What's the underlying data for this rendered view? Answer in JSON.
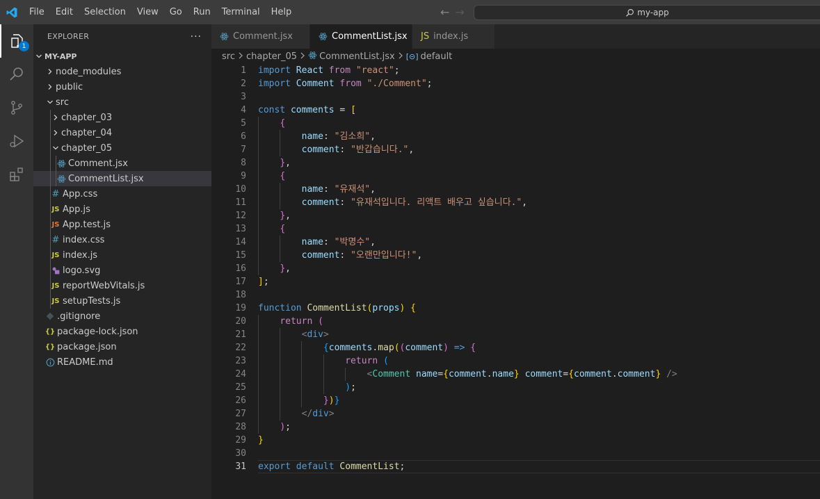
{
  "menu": [
    "File",
    "Edit",
    "Selection",
    "View",
    "Go",
    "Run",
    "Terminal",
    "Help"
  ],
  "search": {
    "text": "my-app"
  },
  "activity": {
    "badge": "1"
  },
  "explorer": {
    "title": "EXPLORER",
    "more": "···",
    "root": "MY-APP",
    "items": [
      {
        "label": "node_modules",
        "type": "folder",
        "depth": 0,
        "expanded": false
      },
      {
        "label": "public",
        "type": "folder",
        "depth": 0,
        "expanded": false
      },
      {
        "label": "src",
        "type": "folder",
        "depth": 0,
        "expanded": true
      },
      {
        "label": "chapter_03",
        "type": "folder",
        "depth": 1,
        "expanded": false
      },
      {
        "label": "chapter_04",
        "type": "folder",
        "depth": 1,
        "expanded": false
      },
      {
        "label": "chapter_05",
        "type": "folder",
        "depth": 1,
        "expanded": true
      },
      {
        "label": "Comment.jsx",
        "type": "react",
        "depth": 2
      },
      {
        "label": "CommentList.jsx",
        "type": "react",
        "depth": 2,
        "selected": true
      },
      {
        "label": "App.css",
        "type": "css",
        "depth": 1
      },
      {
        "label": "App.js",
        "type": "js",
        "depth": 1
      },
      {
        "label": "App.test.js",
        "type": "test",
        "depth": 1
      },
      {
        "label": "index.css",
        "type": "css",
        "depth": 1
      },
      {
        "label": "index.js",
        "type": "js",
        "depth": 1
      },
      {
        "label": "logo.svg",
        "type": "svg",
        "depth": 1
      },
      {
        "label": "reportWebVitals.js",
        "type": "js",
        "depth": 1
      },
      {
        "label": "setupTests.js",
        "type": "js",
        "depth": 1
      },
      {
        "label": ".gitignore",
        "type": "git",
        "depth": 0
      },
      {
        "label": "package-lock.json",
        "type": "json",
        "depth": 0
      },
      {
        "label": "package.json",
        "type": "json",
        "depth": 0
      },
      {
        "label": "README.md",
        "type": "info",
        "depth": 0
      }
    ]
  },
  "tabs": [
    {
      "label": "Comment.jsx",
      "icon": "react",
      "active": false
    },
    {
      "label": "CommentList.jsx",
      "icon": "react",
      "active": true,
      "modified": true
    },
    {
      "label": "index.js",
      "icon": "js",
      "active": false
    }
  ],
  "breadcrumb": [
    "src",
    "chapter_05",
    "CommentList.jsx",
    "default"
  ],
  "editor": {
    "current_line": 31,
    "lines": [
      [
        [
          "kw",
          "import "
        ],
        [
          "var",
          "React "
        ],
        [
          "ctl",
          "from "
        ],
        [
          "str",
          "\"react\""
        ],
        [
          "p",
          ";"
        ]
      ],
      [
        [
          "kw",
          "import "
        ],
        [
          "var",
          "Comment "
        ],
        [
          "ctl",
          "from "
        ],
        [
          "str",
          "\"./Comment\""
        ],
        [
          "p",
          ";"
        ]
      ],
      [],
      [
        [
          "kw",
          "const "
        ],
        [
          "var",
          "comments "
        ],
        [
          "p",
          "= "
        ],
        [
          "b1",
          "["
        ]
      ],
      [
        [
          "p",
          "    "
        ],
        [
          "b2",
          "{"
        ]
      ],
      [
        [
          "p",
          "        "
        ],
        [
          "var",
          "name"
        ],
        [
          "p",
          ": "
        ],
        [
          "str",
          "\"김소희\""
        ],
        [
          "p",
          ","
        ]
      ],
      [
        [
          "p",
          "        "
        ],
        [
          "var",
          "comment"
        ],
        [
          "p",
          ": "
        ],
        [
          "str",
          "\"반갑습니다.\""
        ],
        [
          "p",
          ","
        ]
      ],
      [
        [
          "p",
          "    "
        ],
        [
          "b2",
          "}"
        ],
        [
          "p",
          ","
        ]
      ],
      [
        [
          "p",
          "    "
        ],
        [
          "b2",
          "{"
        ]
      ],
      [
        [
          "p",
          "        "
        ],
        [
          "var",
          "name"
        ],
        [
          "p",
          ": "
        ],
        [
          "str",
          "\"유재석\""
        ],
        [
          "p",
          ","
        ]
      ],
      [
        [
          "p",
          "        "
        ],
        [
          "var",
          "comment"
        ],
        [
          "p",
          ": "
        ],
        [
          "str",
          "\"유재석입니다. 리액트 배우고 싶습니다.\""
        ],
        [
          "p",
          ","
        ]
      ],
      [
        [
          "p",
          "    "
        ],
        [
          "b2",
          "}"
        ],
        [
          "p",
          ","
        ]
      ],
      [
        [
          "p",
          "    "
        ],
        [
          "b2",
          "{"
        ]
      ],
      [
        [
          "p",
          "        "
        ],
        [
          "var",
          "name"
        ],
        [
          "p",
          ": "
        ],
        [
          "str",
          "\"박명수\""
        ],
        [
          "p",
          ","
        ]
      ],
      [
        [
          "p",
          "        "
        ],
        [
          "var",
          "comment"
        ],
        [
          "p",
          ": "
        ],
        [
          "str",
          "\"오랜만입니다!\""
        ],
        [
          "p",
          ","
        ]
      ],
      [
        [
          "p",
          "    "
        ],
        [
          "b2",
          "}"
        ],
        [
          "p",
          ","
        ]
      ],
      [
        [
          "b1",
          "]"
        ],
        [
          "p",
          ";"
        ]
      ],
      [],
      [
        [
          "kw",
          "function "
        ],
        [
          "fn",
          "CommentList"
        ],
        [
          "b1",
          "("
        ],
        [
          "var",
          "props"
        ],
        [
          "b1",
          ")"
        ],
        [
          "p",
          " "
        ],
        [
          "b1",
          "{"
        ]
      ],
      [
        [
          "p",
          "    "
        ],
        [
          "ctl",
          "return "
        ],
        [
          "b2",
          "("
        ]
      ],
      [
        [
          "p",
          "        "
        ],
        [
          "tagc",
          "<"
        ],
        [
          "tag",
          "div"
        ],
        [
          "tagc",
          ">"
        ]
      ],
      [
        [
          "p",
          "            "
        ],
        [
          "b3",
          "{"
        ],
        [
          "var",
          "comments"
        ],
        [
          "p",
          "."
        ],
        [
          "fn",
          "map"
        ],
        [
          "b1",
          "("
        ],
        [
          "b2",
          "("
        ],
        [
          "var",
          "comment"
        ],
        [
          "b2",
          ")"
        ],
        [
          "p",
          " "
        ],
        [
          "kw",
          "=>"
        ],
        [
          "p",
          " "
        ],
        [
          "b2",
          "{"
        ]
      ],
      [
        [
          "p",
          "                "
        ],
        [
          "ctl",
          "return "
        ],
        [
          "b3",
          "("
        ]
      ],
      [
        [
          "p",
          "                    "
        ],
        [
          "tagc",
          "<"
        ],
        [
          "cls",
          "Comment "
        ],
        [
          "var",
          "name"
        ],
        [
          "p",
          "="
        ],
        [
          "b1",
          "{"
        ],
        [
          "var",
          "comment"
        ],
        [
          "p",
          "."
        ],
        [
          "var",
          "name"
        ],
        [
          "b1",
          "}"
        ],
        [
          "p",
          " "
        ],
        [
          "var",
          "comment"
        ],
        [
          "p",
          "="
        ],
        [
          "b1",
          "{"
        ],
        [
          "var",
          "comment"
        ],
        [
          "p",
          "."
        ],
        [
          "var",
          "comment"
        ],
        [
          "b1",
          "}"
        ],
        [
          "p",
          " "
        ],
        [
          "tagc",
          "/>"
        ]
      ],
      [
        [
          "p",
          "                "
        ],
        [
          "b3",
          ")"
        ],
        [
          "p",
          ";"
        ]
      ],
      [
        [
          "p",
          "            "
        ],
        [
          "b2",
          "}"
        ],
        [
          "b1",
          ")"
        ],
        [
          "b3",
          "}"
        ]
      ],
      [
        [
          "p",
          "        "
        ],
        [
          "tagc",
          "</"
        ],
        [
          "tag",
          "div"
        ],
        [
          "tagc",
          ">"
        ]
      ],
      [
        [
          "p",
          "    "
        ],
        [
          "b2",
          ")"
        ],
        [
          "p",
          ";"
        ]
      ],
      [
        [
          "b1",
          "}"
        ]
      ],
      [],
      [
        [
          "kw",
          "export "
        ],
        [
          "kw",
          "default "
        ],
        [
          "fn",
          "CommentList"
        ],
        [
          "p",
          ";"
        ]
      ]
    ]
  },
  "colors": {
    "accent": "#0078d4",
    "keyword": "#569cd6",
    "control": "#c586c0",
    "string": "#ce9178",
    "function": "#dcdcaa"
  }
}
